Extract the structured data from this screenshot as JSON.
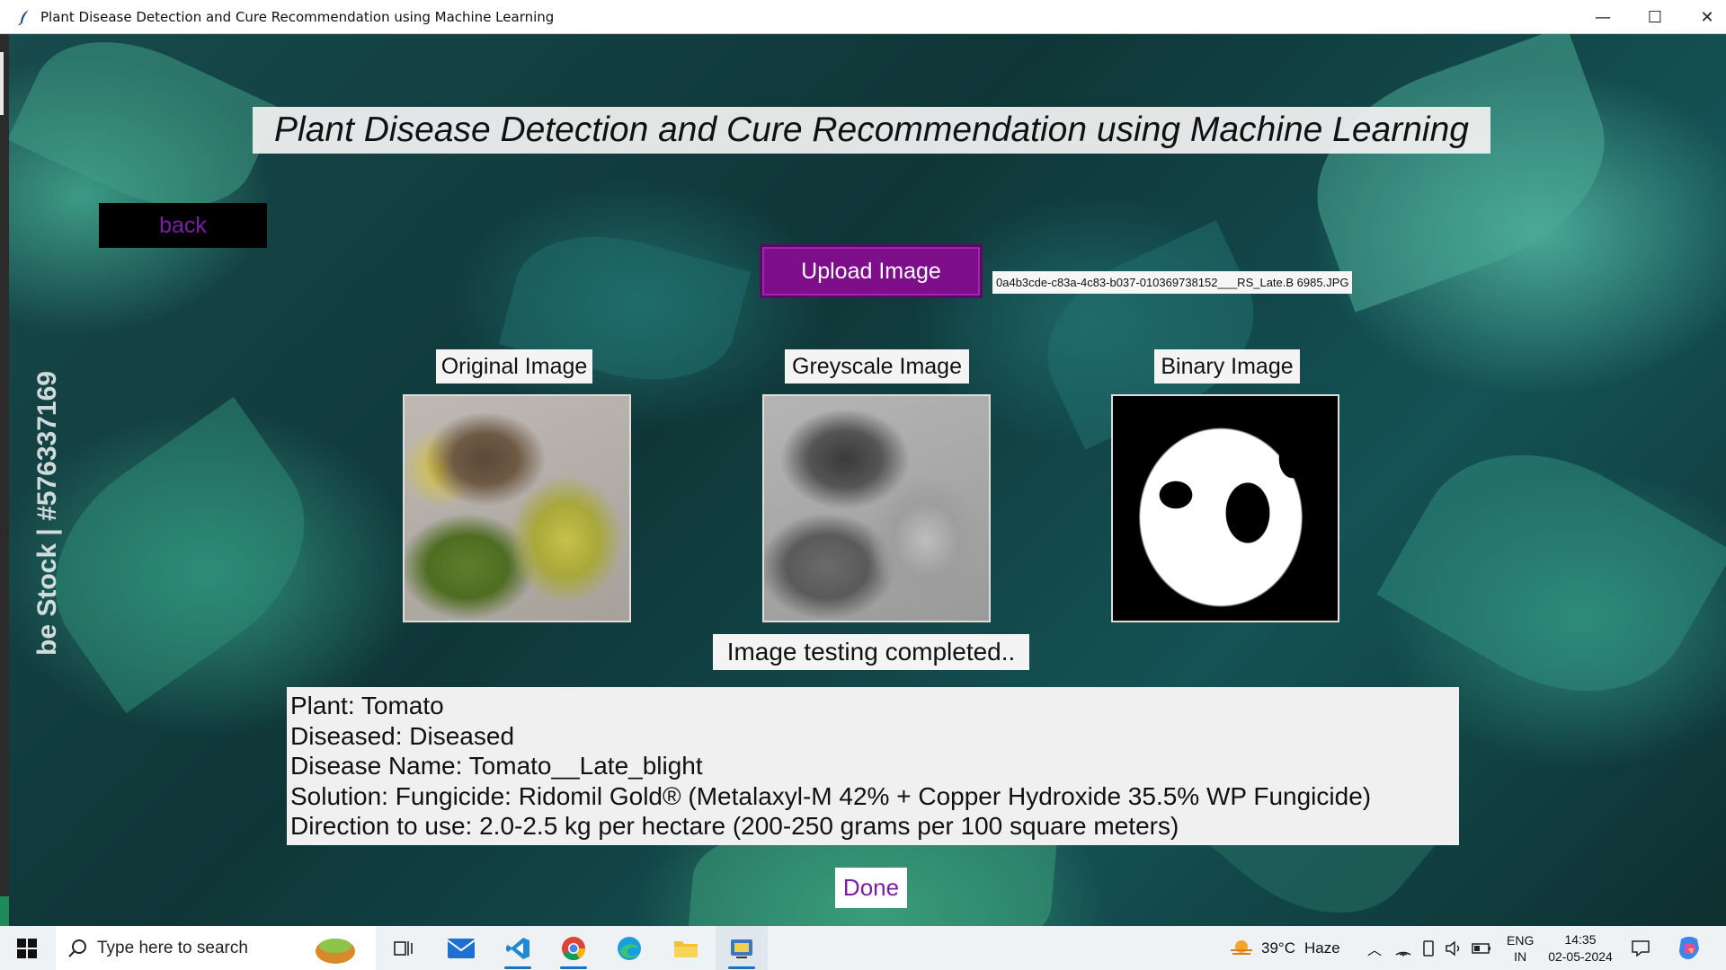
{
  "window": {
    "title": "Plant Disease Detection and Cure Recommendation using Machine Learning",
    "controls": {
      "minimize": "—",
      "maximize": "☐",
      "close": "✕"
    }
  },
  "app": {
    "heading": "Plant Disease Detection and Cure Recommendation using Machine Learning",
    "back_label": "back",
    "upload_label": "Upload Image",
    "filename": "0a4b3cde-c83a-4c83-b037-010369738152___RS_Late.B 6985.JPG",
    "images": {
      "original_label": "Original Image",
      "greyscale_label": "Greyscale Image",
      "binary_label": "Binary Image"
    },
    "status": "Image testing completed..",
    "results": {
      "plant": "Plant: Tomato",
      "diseased": "Diseased: Diseased",
      "disease_name": "Disease Name: Tomato__Late_blight",
      "solution": "Solution: Fungicide: Ridomil Gold® (Metalaxyl-M 42% + Copper Hydroxide 35.5% WP Fungicide)",
      "direction": "Direction to use: 2.0-2.5 kg per hectare (200-250 grams per 100 square meters)"
    },
    "done_label": "Done",
    "watermark": "be Stock | #576337169"
  },
  "taskbar": {
    "search_placeholder": "Type here to search",
    "weather_temp": "39°C",
    "weather_desc": "Haze",
    "lang_top": "ENG",
    "lang_bottom": "IN",
    "time": "14:35",
    "date": "02-05-2024"
  },
  "colors": {
    "purple_button": "#7e0e8a",
    "back_text": "#7b1fa2",
    "done_text": "#7b1fa2"
  }
}
